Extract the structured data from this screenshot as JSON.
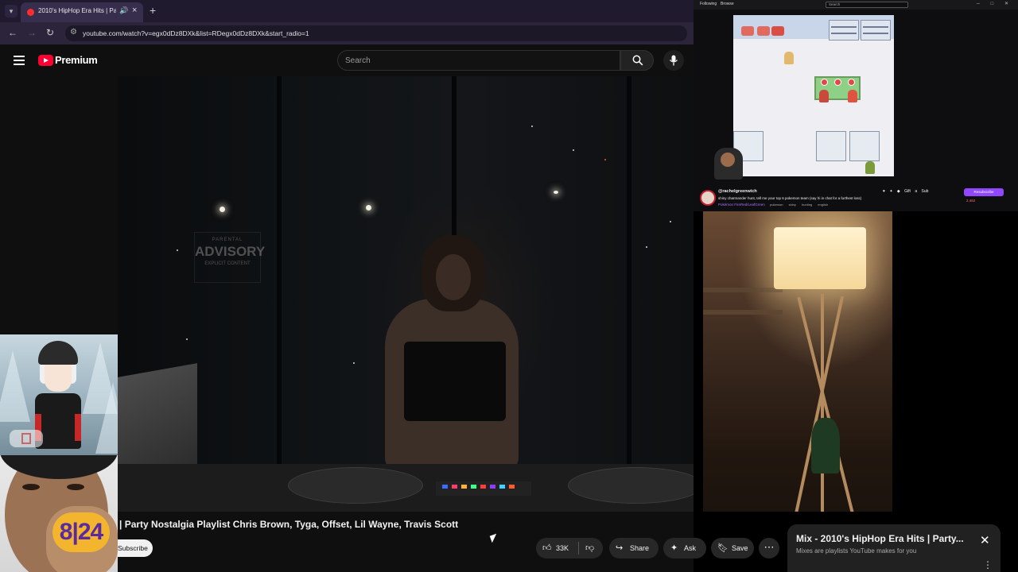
{
  "browser": {
    "tab_title": "2010's HipHop Era Hits | Pa",
    "url": "youtube.com/watch?v=egx0dDz8DXk&list=RDegx0dDz8DXk&start_radio=1"
  },
  "youtube": {
    "brand": "Premium",
    "search_placeholder": "Search"
  },
  "video": {
    "poster_lines": [
      "PARENTAL",
      "ADVISORY",
      "EXPLICIT CONTENT"
    ],
    "title": "| Party Nostalgia Playlist Chris Brown, Tyga, Offset, Lil Wayne, Travis Scott"
  },
  "actions": {
    "subscribe": "Subscribe",
    "likes": "33K",
    "share": "Share",
    "ask": "Ask",
    "save": "Save"
  },
  "mix_panel": {
    "title": "Mix - 2010's HipHop Era Hits | Party...",
    "subtitle": "Mixes are playlists YouTube makes for you"
  },
  "stream_window": {
    "tabs": [
      "Following",
      "Browse"
    ],
    "search_placeholder": "Search",
    "channel": "@rachelgreenwich",
    "stream_title": "shiny charmander hunt, tell me your top 6 pokemon team (say hi in chat for a furthest loss)",
    "category": "Pokémon FireRed/LeafGreen",
    "tags": "pokemon  shiny  hunting  english",
    "gift": "Gift a Sub",
    "subscribe": "Resubscribe",
    "viewers": "2,462"
  },
  "webcam": {
    "jersey_number": "8|24"
  },
  "colors": {
    "youtube_red": "#ff0033",
    "twitch_purple": "#9147ff",
    "browser_frame": "#2b243a"
  }
}
